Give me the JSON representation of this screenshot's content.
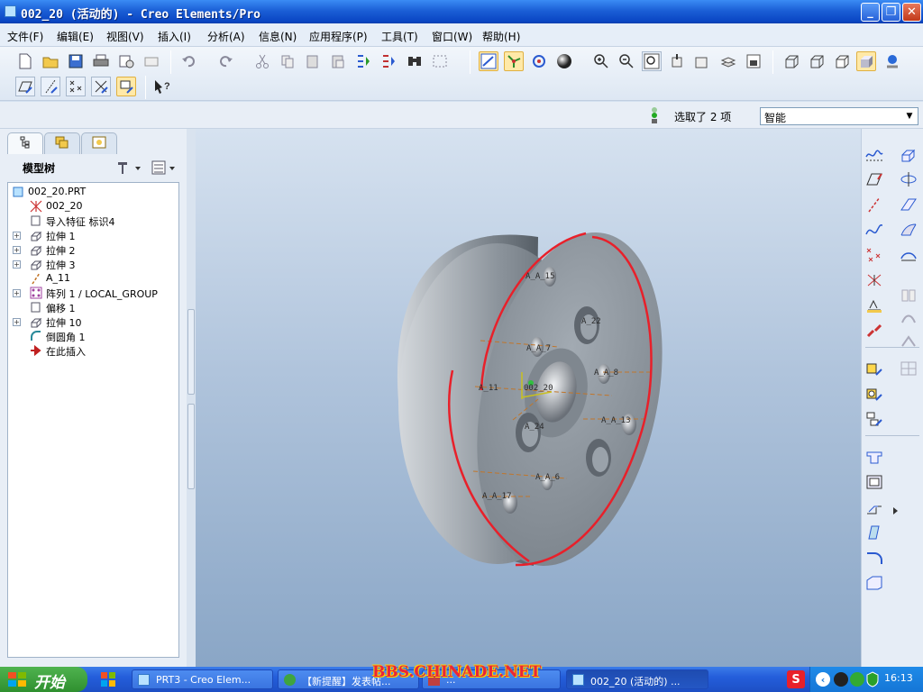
{
  "window": {
    "title": "002_20 (活动的) - Creo Elements/Pro"
  },
  "menu": [
    "文件(F)",
    "编辑(E)",
    "视图(V)",
    "插入(I)",
    "分析(A)",
    "信息(N)",
    "应用程序(P)",
    "工具(T)",
    "窗口(W)",
    "帮助(H)"
  ],
  "status": {
    "selection_text": "选取了 2 项",
    "filter_value": "智能"
  },
  "left_panel": {
    "tabs": [
      "model-tree",
      "folder-browser",
      "favorites"
    ],
    "title": "模型树",
    "tree": [
      {
        "label": "002_20.PRT",
        "expandable": false,
        "level": 0,
        "icon": "part"
      },
      {
        "label": "002_20",
        "expandable": false,
        "level": 1,
        "icon": "csys"
      },
      {
        "label": "导入特征 标识4",
        "expandable": false,
        "level": 1,
        "icon": "import"
      },
      {
        "label": "拉伸 1",
        "expandable": true,
        "level": 1,
        "icon": "extrude"
      },
      {
        "label": "拉伸 2",
        "expandable": true,
        "level": 1,
        "icon": "extrude"
      },
      {
        "label": "拉伸 3",
        "expandable": true,
        "level": 1,
        "icon": "extrude"
      },
      {
        "label": "A_11",
        "expandable": false,
        "level": 1,
        "icon": "axis"
      },
      {
        "label": "阵列 1 / LOCAL_GROUP",
        "expandable": true,
        "level": 1,
        "icon": "pattern"
      },
      {
        "label": "偏移 1",
        "expandable": false,
        "level": 1,
        "icon": "offset"
      },
      {
        "label": "拉伸 10",
        "expandable": true,
        "level": 1,
        "icon": "extrude"
      },
      {
        "label": "倒圆角 1",
        "expandable": false,
        "level": 1,
        "icon": "round"
      },
      {
        "label": "在此插入",
        "expandable": false,
        "level": 1,
        "icon": "insert"
      }
    ]
  },
  "viewport": {
    "axis_labels": [
      "A_A_15",
      "A_22",
      "A_A_7",
      "A_A_8",
      "A_11",
      "002_20",
      "A_A_13",
      "A_24",
      "A_A_6",
      "A_A_17"
    ],
    "colors": {
      "highlight": "#e8202a",
      "model": "#8e969e",
      "axis": "#c0762c"
    }
  },
  "taskbar": {
    "start_label": "开始",
    "tasks": [
      {
        "label": "PRT3 - Creo Elem...",
        "active": false
      },
      {
        "label": "【新提醒】发表帖...",
        "active": false
      },
      {
        "label": "...",
        "active": false
      },
      {
        "label": "002_20 (活动的) ...",
        "active": true
      }
    ],
    "clock": "16:13",
    "watermark": "BBS.CHINADE.NET"
  }
}
